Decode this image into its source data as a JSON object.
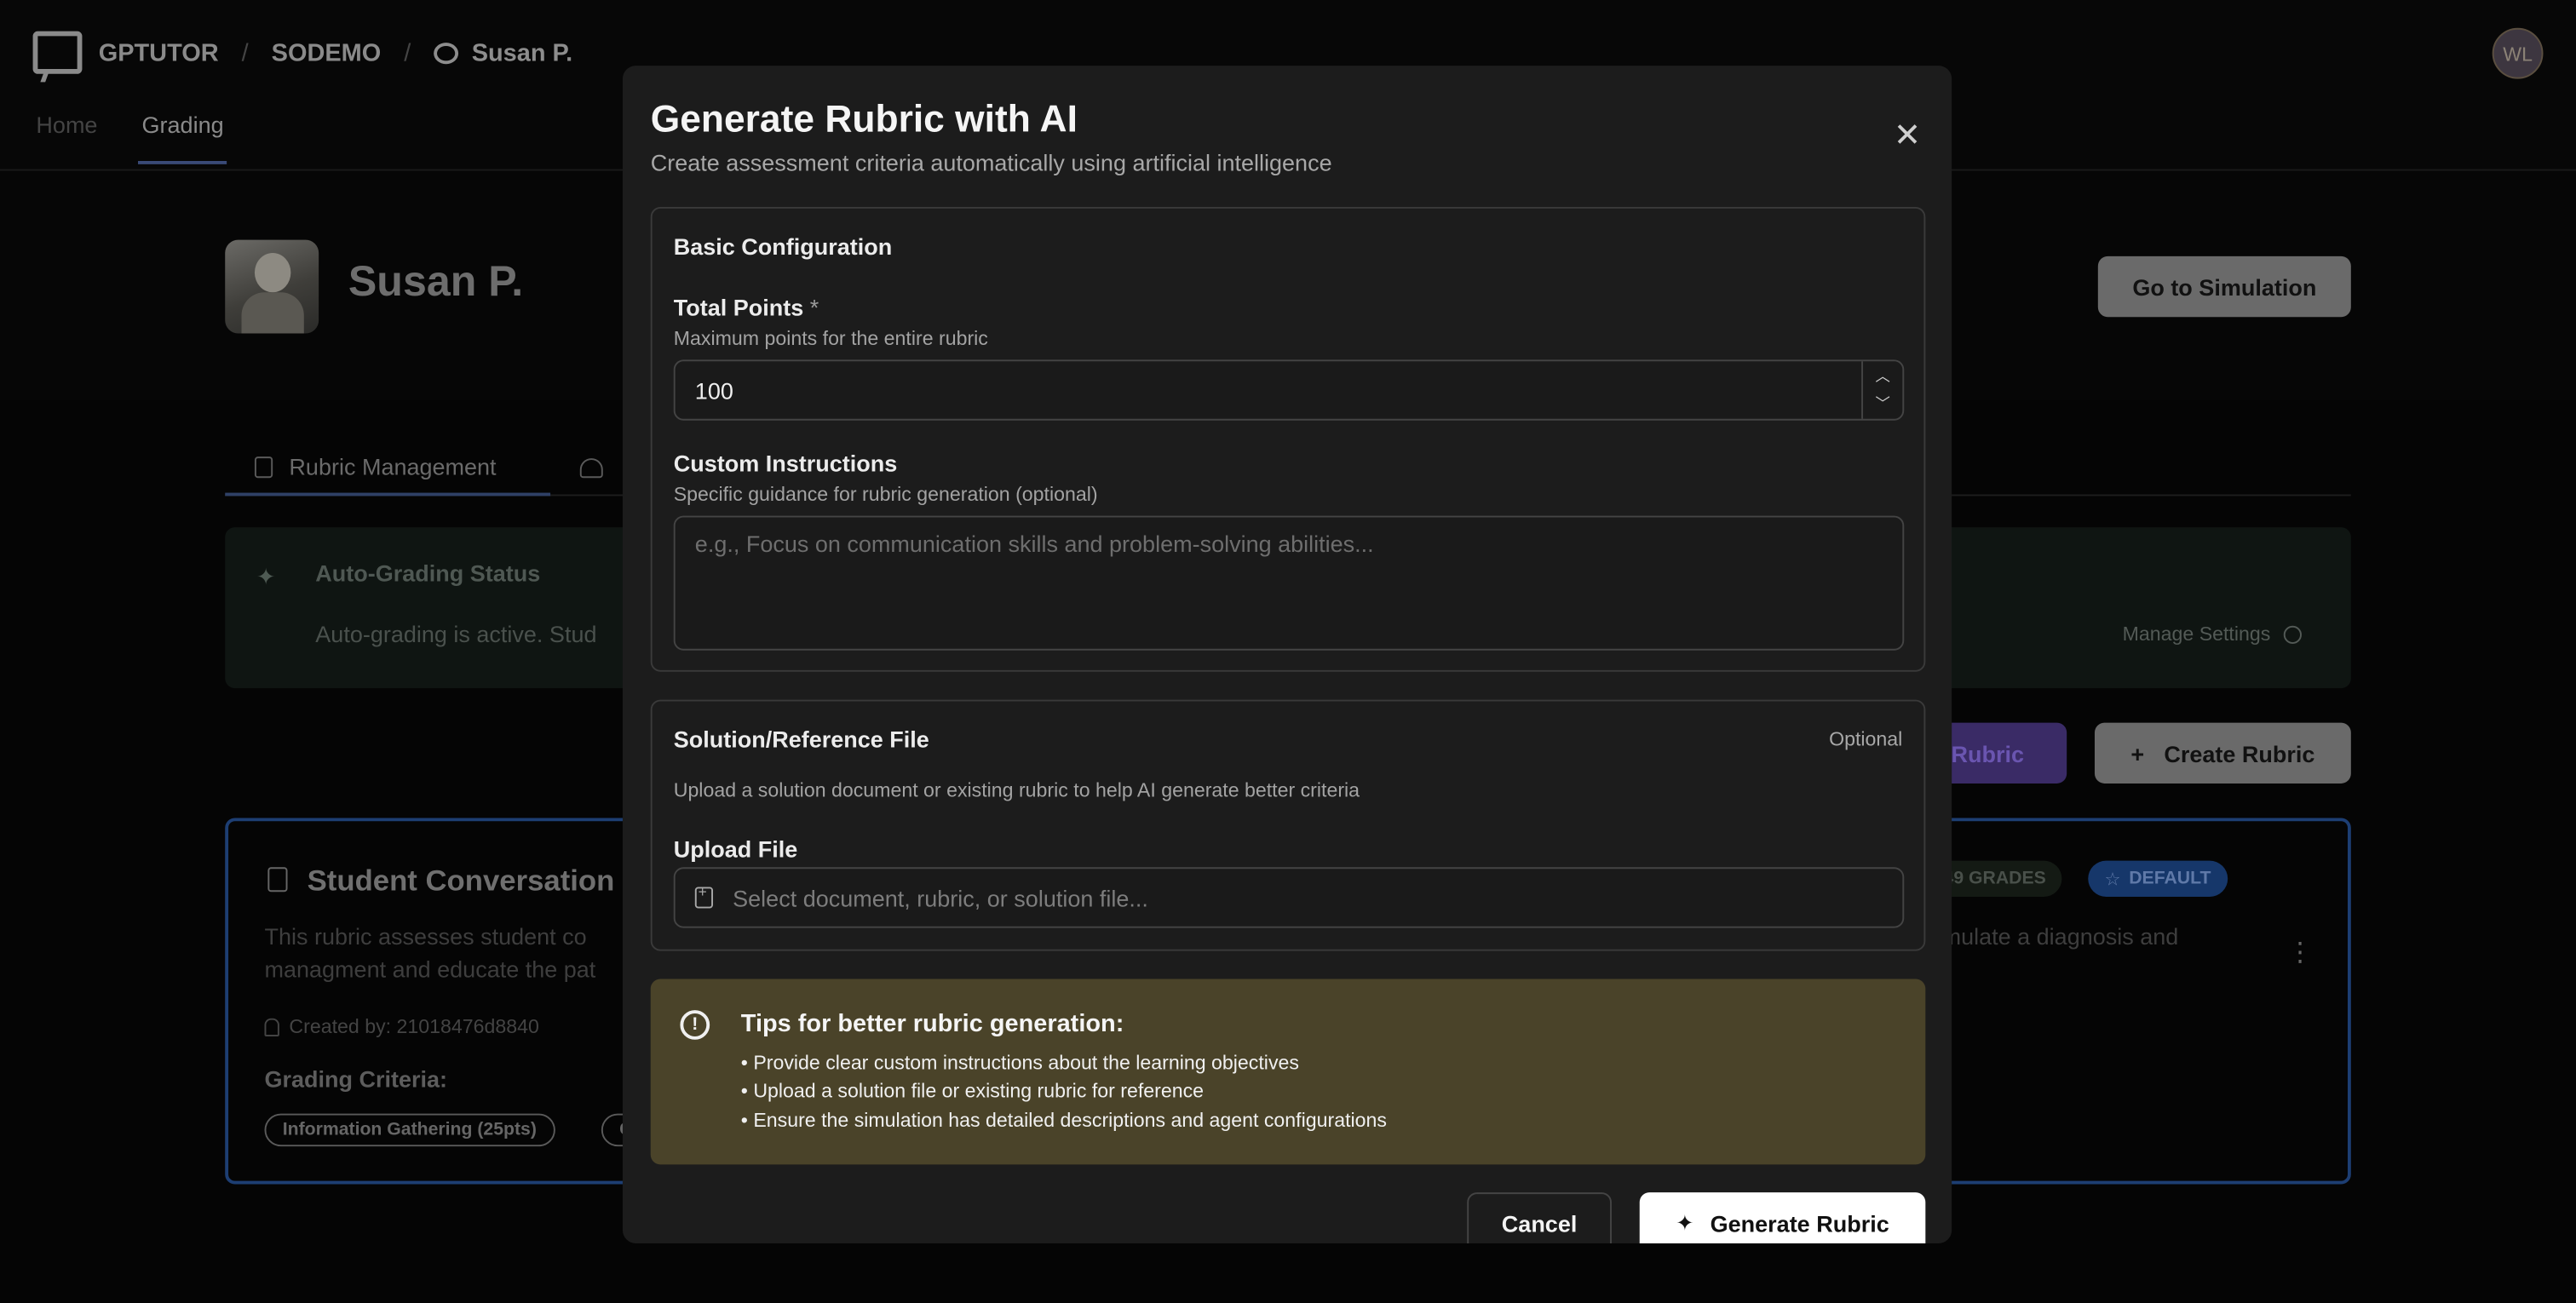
{
  "header": {
    "brand": "GPTUTOR",
    "org": "SODEMO",
    "user_crumb": "Susan P.",
    "avatar_initials": "WL",
    "nav": [
      {
        "label": "Home",
        "active": false
      },
      {
        "label": "Grading",
        "active": true
      }
    ]
  },
  "hero": {
    "name": "Susan P.",
    "go_to_simulation": "Go to Simulation"
  },
  "tabs": {
    "rubric_management": "Rubric Management"
  },
  "auto_grading": {
    "title": "Auto-Grading Status",
    "text": "Auto-grading is active. Stud",
    "manage_settings": "Manage Settings"
  },
  "actions": {
    "ai_rubric": "e Rubric",
    "create_rubric": "Create Rubric"
  },
  "rubric_card": {
    "title": "Student Conversation",
    "desc_line1": "This rubric assesses student co",
    "desc_line2": "managment and educate the pat",
    "desc_right": "mulate a diagnosis and",
    "created_by": "Created by: 21018476d8840",
    "grades_badge": "49 GRADES",
    "default_badge": "DEFAULT",
    "criteria_label": "Grading Criteria:",
    "chips": [
      "Information Gathering (25pts)",
      "C"
    ]
  },
  "modal": {
    "title": "Generate Rubric with AI",
    "subtitle": "Create assessment criteria automatically using artificial intelligence",
    "basic": {
      "title": "Basic Configuration",
      "total_points_label": "Total Points",
      "required_mark": "*",
      "total_points_help": "Maximum points for the entire rubric",
      "total_points_value": "100",
      "custom_label": "Custom Instructions",
      "custom_help": "Specific guidance for rubric generation (optional)",
      "custom_placeholder": "e.g., Focus on communication skills and problem-solving abilities..."
    },
    "file": {
      "title": "Solution/Reference File",
      "optional": "Optional",
      "help": "Upload a solution document or existing rubric to help AI generate better criteria",
      "upload_label": "Upload File",
      "placeholder": "Select document, rubric, or solution file..."
    },
    "tips": {
      "title": "Tips for better rubric generation:",
      "items": [
        "• Provide clear custom instructions about the learning objectives",
        "• Upload a solution file or existing rubric for reference",
        "• Ensure the simulation has detailed descriptions and agent configurations"
      ]
    },
    "cancel": "Cancel",
    "generate": "Generate Rubric"
  }
}
